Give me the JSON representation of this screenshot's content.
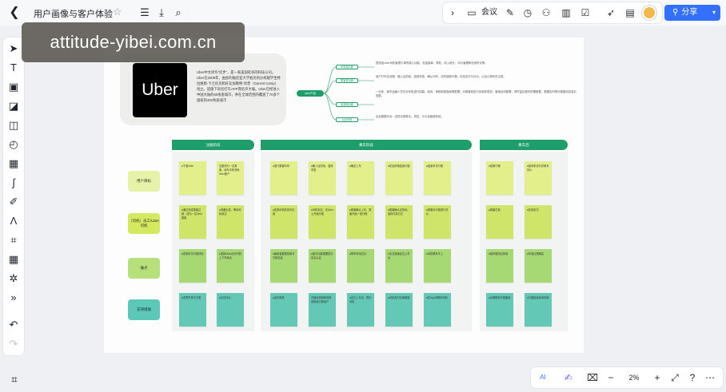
{
  "doc": {
    "title": "用户画像与客户体验"
  },
  "toolbar": {
    "meeting_label": "会议"
  },
  "share": {
    "label": "分享"
  },
  "watermark": "attitude-yibei.com.cn",
  "zoom": "2%",
  "bottom_ai_label": "AI",
  "uber": {
    "logo_text": "Uber",
    "description": "Uber中文译作“优步”，是一家美国硅谷的科技公司。Uber在2009年，由加利福尼亚大学伯克利分校辍学生特拉维斯·卡兰尼克和好友加勒特·坎普（Garrett Camp）创立。因旗下同名打车APP而名声大噪。Uber已经进入中国大陆的60余座城市，并在全球范围内覆盖了70多个国家的400余座城市"
  },
  "mindmap": {
    "root": "uber产品",
    "branches": [
      "司机端功能",
      "乘客端功能",
      "运营端功能",
      "后台系统"
    ],
    "texts": [
      "提供给Uber司机管理订单的核心功能，包括接单、导航、收入统计、评价管理和在线时长等。",
      "用户打车全流程：输入目的地、选择车型、确认叫车、实时追踪行程、在线支付与评价，以及订单历史记录。",
      "一对多，城市运营人员可对司机进行招募、培训、审核和奖励政策配置；对乘客则进行优惠券发放、营销活动配置；同时监控城市供需数据，根据实时情况调整动态溢价倍数。",
      "后台数据平台：支撑派单算法、风控、计价及客服系统。"
    ]
  },
  "headers": [
    "注册阶段",
    "乘车阶段",
    "乘车后"
  ],
  "rows": [
    "用户目标",
    "（司机）员工/Uber司机",
    "痛点",
    "支持措施"
  ],
  "stickies": [
    "●下载Uber",
    "注册成为一名乘客，填写手机号码Uber账户",
    "●进行乘客叫车",
    "●输入目的地，选择车型",
    "●确定上车",
    "●在目的地结束行程",
    "●结束本次行程",
    "●查看行程",
    "●给司机评分并填写评价",
    "●通过完成乘客注册，成为一名Uber乘客",
    "●准备出发，等待司机到达",
    "●查看司机的实时位置",
    "●司机到达，在Uber上开始行程",
    "●乘客确认上车，乘客开始一段行程",
    "●乘客确认目的地，选择付费方式",
    "●乘客对行程进行评价",
    "●乘客付费",
    "●在线支付",
    "●查看本次行程详情",
    "●选择Uber出行时的上下车地点",
    "●使用者要提前填写付款信息",
    "●部分功能需要首次实名认证",
    "●等车时间过长",
    "●无法准确定位上车点",
    "●司机联系不上",
    "●临时更改目的地",
    "●车费比预期高",
    "●发票开具不方便",
    "●忘记评价",
    "●遗失物品",
    "开通优惠券和首单减免吸引新用户",
    "●定位上车点，提示司机",
    "●司机实时位置更新",
    "●在App内联系司机",
    "●合理规划行程路线",
    "●行程结束自动扣款",
    "●价格透明可预估",
    "●电子发票",
    "●评价奖励",
    "●客服协助找回"
  ]
}
